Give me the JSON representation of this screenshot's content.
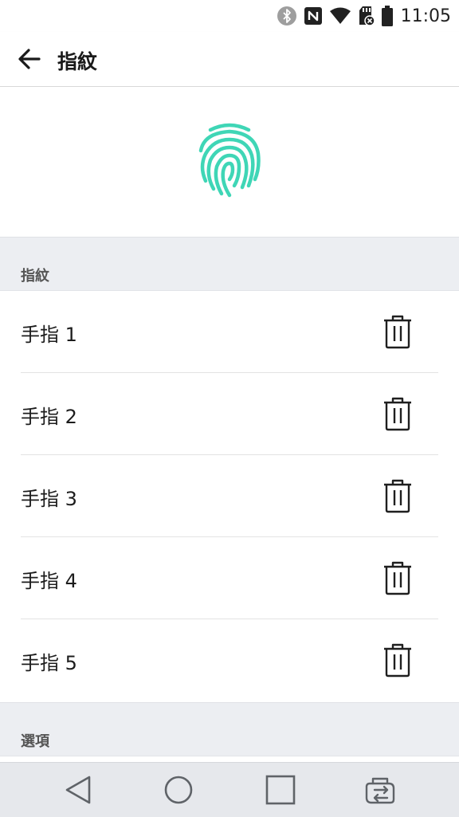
{
  "status_bar": {
    "time": "11:05"
  },
  "app_bar": {
    "title": "指紋"
  },
  "sections": {
    "fingerprints_header": "指紋",
    "options_header": "選項"
  },
  "fingerprints": [
    {
      "label": "手指 1"
    },
    {
      "label": "手指 2"
    },
    {
      "label": "手指 3"
    },
    {
      "label": "手指 4"
    },
    {
      "label": "手指 5"
    }
  ],
  "colors": {
    "accent": "#3fd6b6",
    "section_bg": "#eceef2",
    "nav_bg": "#e6e8ec"
  },
  "icons": {
    "status": [
      "bluetooth-icon",
      "nfc-icon",
      "wifi-icon",
      "sd-card-icon",
      "battery-icon"
    ],
    "nav": [
      "back-nav-icon",
      "home-nav-icon",
      "recents-nav-icon",
      "dual-window-icon"
    ]
  }
}
